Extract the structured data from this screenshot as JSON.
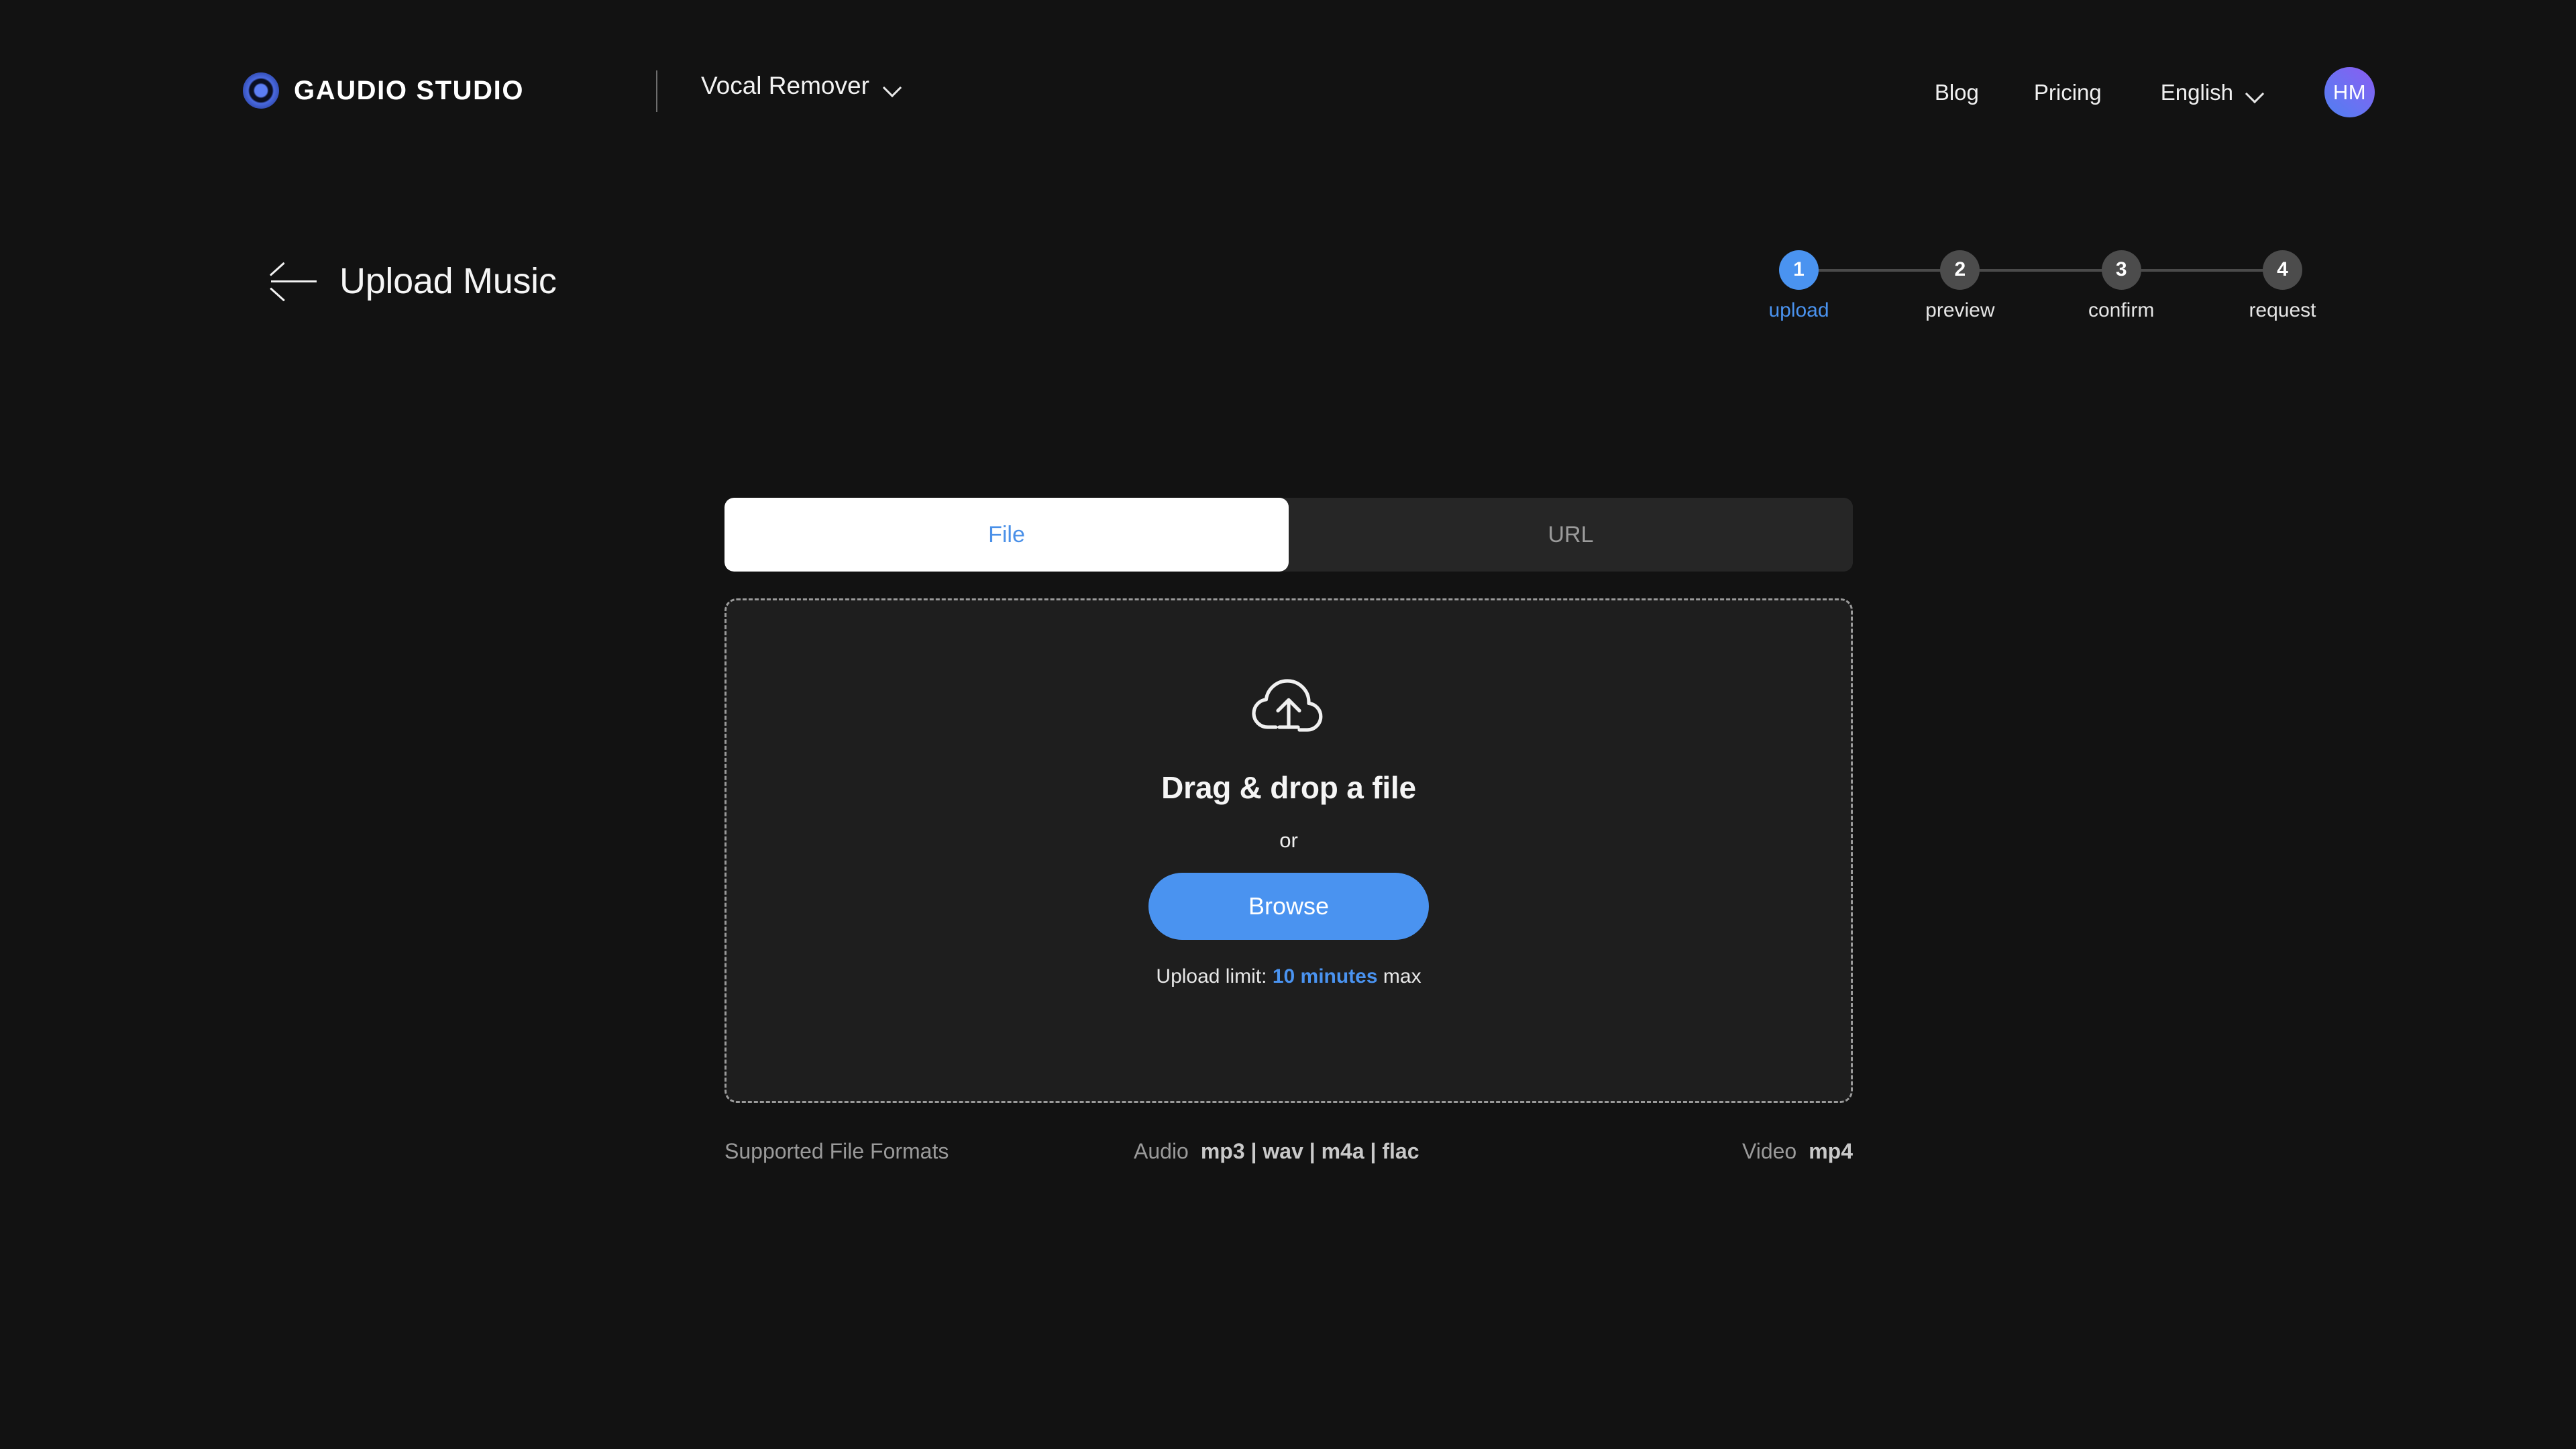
{
  "header": {
    "brand": "GAUDIO STUDIO",
    "logo_icon": "gaudio-circle-logo",
    "product": "Vocal Remover",
    "product_chevron_icon": "chevron-down-icon",
    "nav": {
      "blog": "Blog",
      "pricing": "Pricing"
    },
    "language": "English",
    "language_chevron_icon": "chevron-down-icon",
    "avatar_initials": "HM"
  },
  "page": {
    "back_icon": "arrow-left-icon",
    "title": "Upload Music"
  },
  "steps": [
    {
      "number": "1",
      "label": "upload",
      "active": true
    },
    {
      "number": "2",
      "label": "preview",
      "active": false
    },
    {
      "number": "3",
      "label": "confirm",
      "active": false
    },
    {
      "number": "4",
      "label": "request",
      "active": false
    }
  ],
  "tabs": [
    {
      "label": "File",
      "active": true
    },
    {
      "label": "URL",
      "active": false
    }
  ],
  "dropzone": {
    "icon": "cloud-upload-icon",
    "title": "Drag & drop a file",
    "or": "or",
    "browse_label": "Browse",
    "limit_prefix": "Upload limit:",
    "limit_value": "10 minutes",
    "limit_suffix": "max"
  },
  "formats": {
    "title": "Supported File Formats",
    "audio_key": "Audio",
    "audio_value": "mp3 | wav | m4a | flac",
    "video_key": "Video",
    "video_value": "mp4"
  },
  "colors": {
    "background": "#121212",
    "accent_blue": "#4a93f0",
    "tab_active_bg": "#ffffff",
    "dropzone_bg": "#1e1e1e",
    "step_inactive": "#4c4c4c"
  }
}
